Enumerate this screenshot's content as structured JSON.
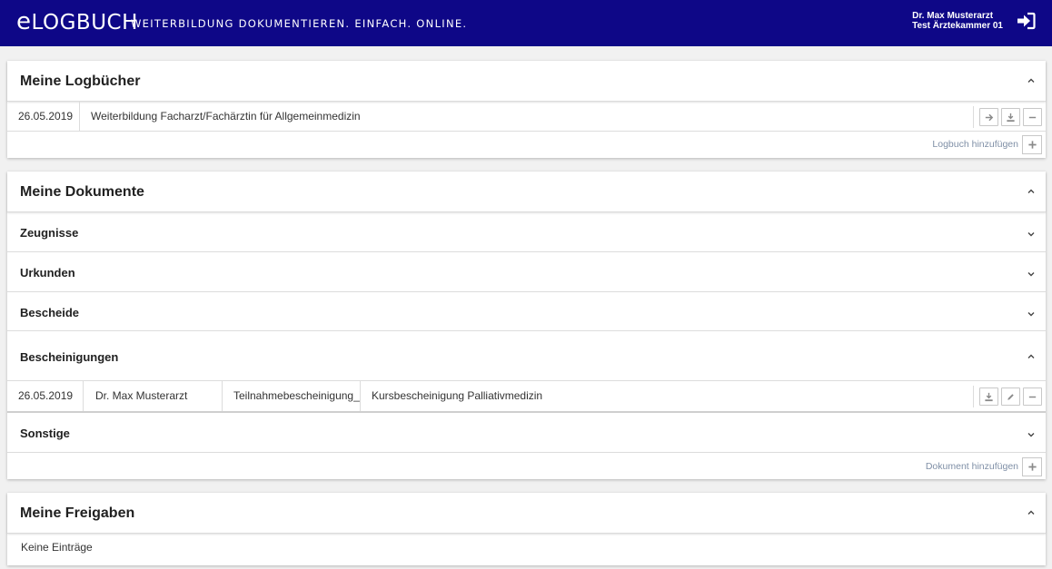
{
  "header": {
    "logo_prefix": "e",
    "logo_main": "LOGBUCH",
    "tagline": "WEITERBILDUNG DOKUMENTIEREN. EINFACH. ONLINE.",
    "user_name": "Dr. Max Musterarzt",
    "user_org": "Test Ärztekammer 01",
    "logout_icon": "sign-in-arrow-icon"
  },
  "logbuecher": {
    "title": "Meine Logbücher",
    "rows": [
      {
        "date": "26.05.2019",
        "name": "Weiterbildung Facharzt/Fachärztin für Allgemeinmedizin"
      }
    ],
    "add_label": "Logbuch hinzufügen"
  },
  "dokumente": {
    "title": "Meine Dokumente",
    "sections": [
      {
        "label": "Zeugnisse",
        "expanded": false
      },
      {
        "label": "Urkunden",
        "expanded": false
      },
      {
        "label": "Bescheide",
        "expanded": false
      },
      {
        "label": "Bescheinigungen",
        "expanded": true
      },
      {
        "label": "Sonstige",
        "expanded": false
      }
    ],
    "bescheinigungen_rows": [
      {
        "date": "26.05.2019",
        "author": "Dr. Max Musterarzt",
        "type": "Teilnahmebescheinigung_",
        "title": "Kursbescheinigung Palliativmedizin"
      }
    ],
    "add_label": "Dokument hinzufügen"
  },
  "freigaben": {
    "title": "Meine Freigaben",
    "empty_text": "Keine Einträge"
  },
  "colors": {
    "header_bg": "#0e0787",
    "muted_link": "#7f8fa6"
  }
}
